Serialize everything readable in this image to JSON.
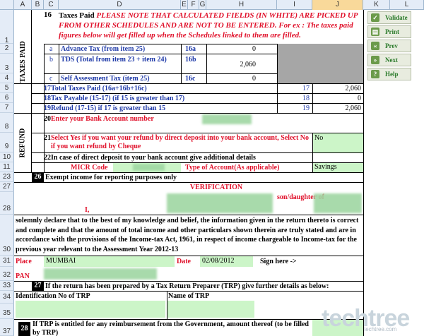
{
  "columns": [
    "A",
    "B",
    "C",
    "D",
    "E",
    "F",
    "G",
    "H",
    "I",
    "J",
    "K",
    "L"
  ],
  "rows": [
    "1",
    "2",
    "3",
    "4",
    "5",
    "6",
    "7",
    "8",
    "9",
    "10",
    "11",
    "23",
    "27",
    "28",
    "30",
    "31",
    "32",
    "33",
    "34",
    "35",
    "37"
  ],
  "section_labels": {
    "taxes_paid": "TAXES PAID",
    "refund": "REFUND"
  },
  "row1": {
    "num": "16",
    "title": "Taxes Paid",
    "note": "PLEASE NOTE THAT CALCULATED FIELDS (IN WHITE) ARE PICKED UP FROM OTHER SCHEDULES AND ARE NOT TO BE ENTERED. For ex : The taxes paid figures below will get filled up when the Schedules linked to them are filled."
  },
  "tax_items": [
    {
      "letter": "a",
      "label": "Advance Tax (from item 25)",
      "code": "16a",
      "value": "0"
    },
    {
      "letter": "b",
      "label": "TDS (Total from item 23 + item 24)",
      "code": "16b",
      "value": "2,060"
    },
    {
      "letter": "c",
      "label": "Self Assessment Tax (item 25)",
      "code": "16c",
      "value": "0"
    }
  ],
  "totals": [
    {
      "num": "17",
      "label": "Total Taxes Paid (16a+16b+16c)",
      "code": "17",
      "value": "2,060"
    },
    {
      "num": "18",
      "label": "Tax Payable (15-17) (if 15 is greater than 17)",
      "code": "18",
      "value": "0"
    },
    {
      "num": "19",
      "label": "Refund (17-15) if 17 is greater than 15",
      "code": "19",
      "value": "2,060"
    }
  ],
  "refund": {
    "r20_num": "20",
    "r20_label": "Enter your Bank Account number",
    "r21_num": "21",
    "r21_label": "Select Yes  if you want your refund by direct  deposit into your bank account, Select No if you want refund by Cheque",
    "r21_value": "No",
    "r22_num": "22",
    "r22_label": "In case of direct deposit to your bank account give additional details",
    "micr_label": "MICR Code",
    "type_label": "Type of Account(As applicable)",
    "type_value": "Savings"
  },
  "exempt": {
    "num": "26",
    "label": "Exempt income for reporting purposes only"
  },
  "verification": {
    "title": "VERIFICATION",
    "i_label": "I,",
    "son_label": "son/daughter of",
    "text": "solemnly declare that to the best of my knowledge and belief, the information given in the return thereto is correct and complete and that the amount of total income and other particulars shown therein are truly stated and are in accordance with the provisions of the Income-tax Act, 1961, in respect of income chargeable to Income-tax for the previous year relevant to the Assessment Year 2012-13",
    "place_label": "Place",
    "place_value": "MUMBAI",
    "date_label": "Date",
    "date_value": "02/08/2012",
    "sign_label": "Sign here ->",
    "pan_label": "PAN"
  },
  "trp": {
    "num": "27",
    "label": "If the return has been prepared by a Tax Return Preparer (TRP) give further details as below:",
    "id_label": "Identification No of TRP",
    "name_label": "Name of TRP",
    "r28_num": "28",
    "r28_label": "If TRP is entitled for any reimbursement from the Government, amount thereof (to be filled by TRP)"
  },
  "buttons": [
    {
      "label": "Validate",
      "icon": "check-icon"
    },
    {
      "label": "Print",
      "icon": "printer-icon"
    },
    {
      "label": "Prev",
      "icon": "double-left-icon"
    },
    {
      "label": "Next",
      "icon": "double-right-icon"
    },
    {
      "label": "Help",
      "icon": "question-icon"
    }
  ],
  "watermark": {
    "brand": "techtree",
    "sub": "techtree.com"
  }
}
